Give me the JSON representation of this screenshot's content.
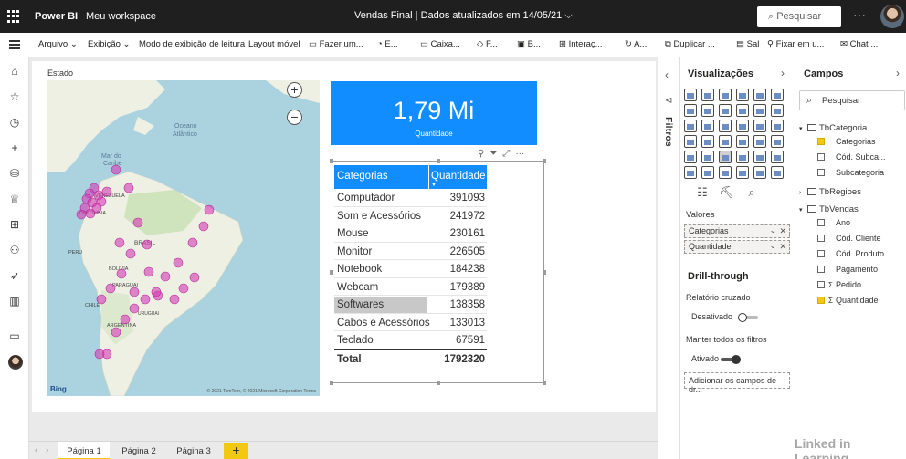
{
  "topbar": {
    "app_name": "Power BI",
    "workspace": "Meu workspace",
    "doc_title": "Vendas Final  |  Dados atualizados em 14/05/21  ⌵",
    "search_placeholder": "Pesquisar",
    "more": "···"
  },
  "ribbon": {
    "items": [
      "Arquivo ⌄",
      "Exibição ⌄",
      "Modo de exibição de leitura",
      "Layout móvel",
      "Fazer um...",
      "E...",
      "Caixa...",
      "F...",
      "B...",
      "Interaç...",
      "A...",
      "Duplicar ...",
      "Sal",
      "Fixar em u...",
      "Chat ..."
    ]
  },
  "canvas": {
    "map_title": "Estado",
    "map": {
      "labels": [
        "Oceano",
        "Atlântico",
        "Mar do",
        "Caribe",
        "VENEZUELA",
        "COLÔMBIA",
        "BRASIL",
        "PERU",
        "BOLÍVIA",
        "PARAGUAI",
        "ARGENTINA",
        "CHILE",
        "URUGUAI"
      ],
      "bing": "Bing",
      "copyright": "© 2021 TomTom, © 2021 Microsoft Corporation  Terms",
      "zoom_in": "+",
      "zoom_out": "−"
    },
    "card": {
      "value": "1,79 Mi",
      "label": "Quantidade"
    },
    "table": {
      "headers": [
        "Categorias",
        "Quantidade"
      ],
      "sort_indicator": "▼",
      "rows": [
        {
          "categoria": "Computador",
          "quantidade": "391093"
        },
        {
          "categoria": "Som e Acessórios",
          "quantidade": "241972"
        },
        {
          "categoria": "Mouse",
          "quantidade": "230161"
        },
        {
          "categoria": "Monitor",
          "quantidade": "226505"
        },
        {
          "categoria": "Notebook",
          "quantidade": "184238"
        },
        {
          "categoria": "Webcam",
          "quantidade": "179389"
        },
        {
          "categoria": "Softwares",
          "quantidade": "138358"
        },
        {
          "categoria": "Cabos e Acessórios",
          "quantidade": "133013"
        },
        {
          "categoria": "Teclado",
          "quantidade": "67591"
        }
      ],
      "total": {
        "label": "Total",
        "value": "1792320"
      }
    },
    "tabs": [
      "Página 1",
      "Página 2",
      "Página 3"
    ],
    "add_tab": "+"
  },
  "filtros": {
    "label": "Filtros"
  },
  "visualizations": {
    "title": "Visualizações",
    "values_label": "Valores",
    "fields": [
      "Categorias",
      "Quantidade"
    ],
    "drill_title": "Drill-through",
    "cross_report": "Relatório cruzado",
    "cross_state": "Desativado",
    "keep_filters": "Manter todos os filtros",
    "keep_state": "Ativado",
    "add_drill": "Adicionar os campos de dr..."
  },
  "fields_pane": {
    "title": "Campos",
    "search_placeholder": "Pesquisar",
    "tables": [
      {
        "name": "TbCategoria",
        "fields": [
          {
            "name": "Categorias",
            "checked": true
          },
          {
            "name": "Cód. Subca...",
            "checked": false
          },
          {
            "name": "Subcategoria",
            "checked": false
          }
        ]
      },
      {
        "name": "TbRegioes",
        "fields": []
      },
      {
        "name": "TbVendas",
        "fields": [
          {
            "name": "Ano",
            "checked": false
          },
          {
            "name": "Cód. Cliente",
            "checked": false
          },
          {
            "name": "Cód. Produto",
            "checked": false
          },
          {
            "name": "Pagamento",
            "checked": false
          },
          {
            "name": "Pedido",
            "checked": false,
            "sigma": true
          },
          {
            "name": "Quantidade",
            "checked": true,
            "sigma": true
          }
        ]
      }
    ]
  },
  "watermark": "Linked in Learning",
  "colors": {
    "accent": "#118dff",
    "bubble": "#d63bb5",
    "tab_accent": "#f2c811"
  }
}
